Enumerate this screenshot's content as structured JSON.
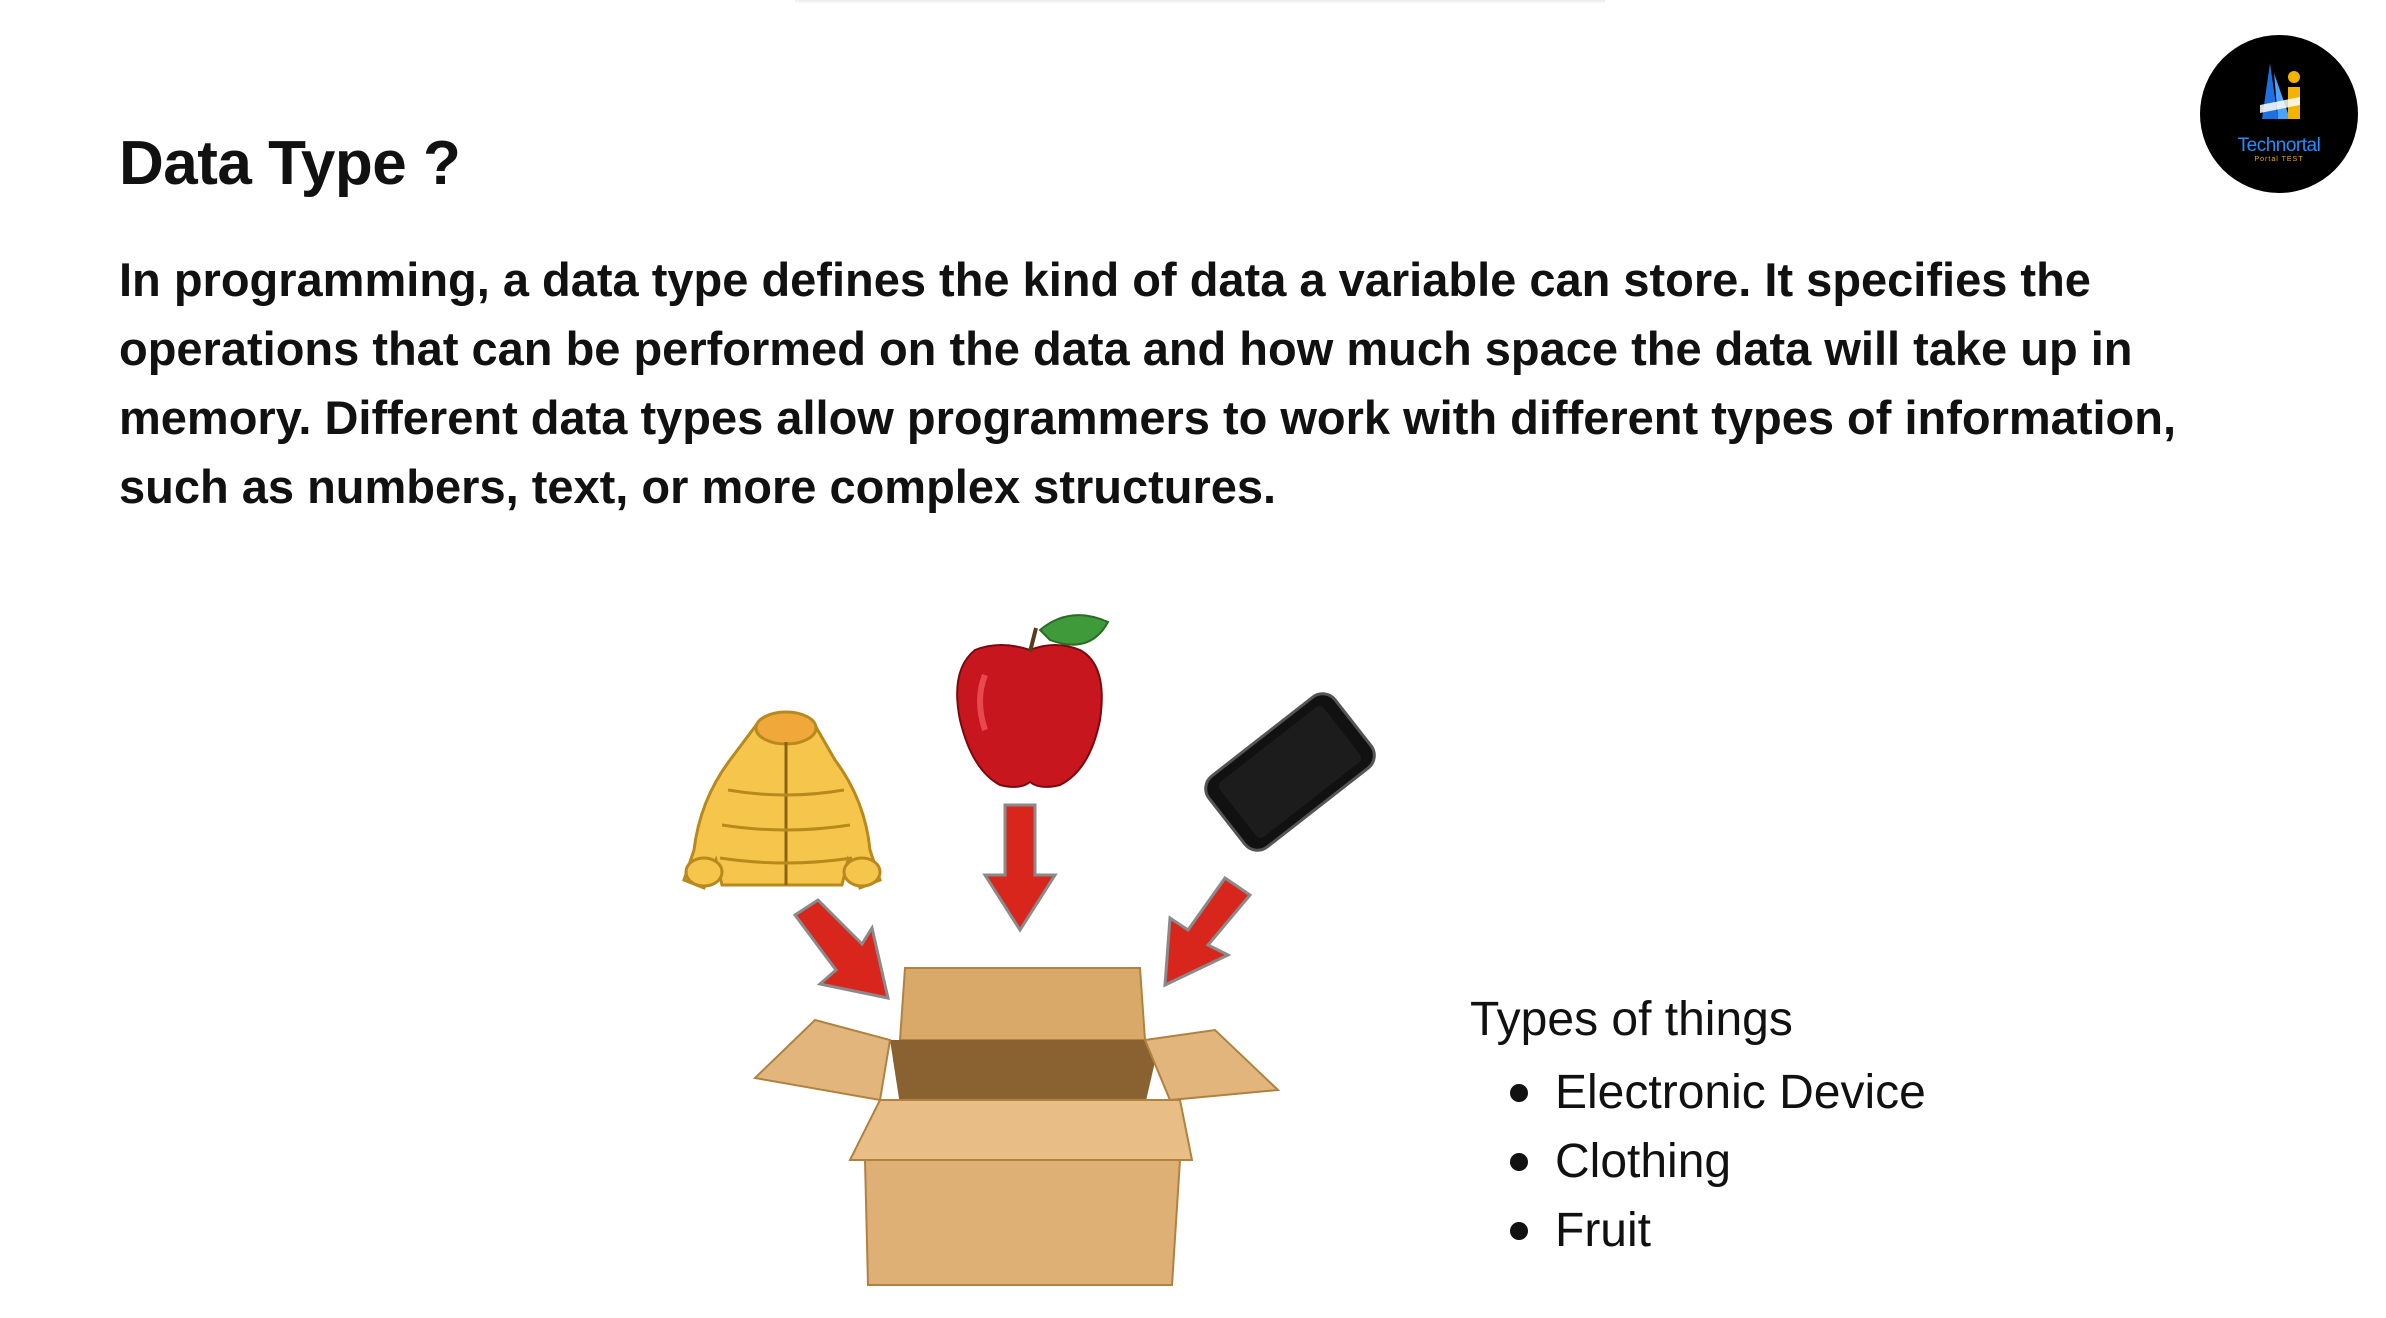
{
  "slide": {
    "title": "Data Type ?",
    "intro": "In programming, a data type defines the kind of data a variable can store. It specifies the operations that can be performed on the data and how much space the data will take up in memory. Different data types allow programmers to work with different types of information, such as numbers, text, or more complex structures."
  },
  "logo": {
    "name": "Technortal",
    "tagline": "Portal TEST"
  },
  "illustration": {
    "items": [
      "jacket-icon",
      "apple-icon",
      "phone-icon",
      "box-icon",
      "arrow-icon"
    ]
  },
  "types": {
    "heading": "Types of things",
    "items": [
      {
        "label": "Electronic Device"
      },
      {
        "label": "Clothing"
      },
      {
        "label": "Fruit"
      }
    ]
  },
  "colors": {
    "arrow": "#d8261c",
    "box": "#e0b47a",
    "jacket": "#f6c64c",
    "apple": "#c8161e",
    "logo_accent": "#1e90ff"
  }
}
